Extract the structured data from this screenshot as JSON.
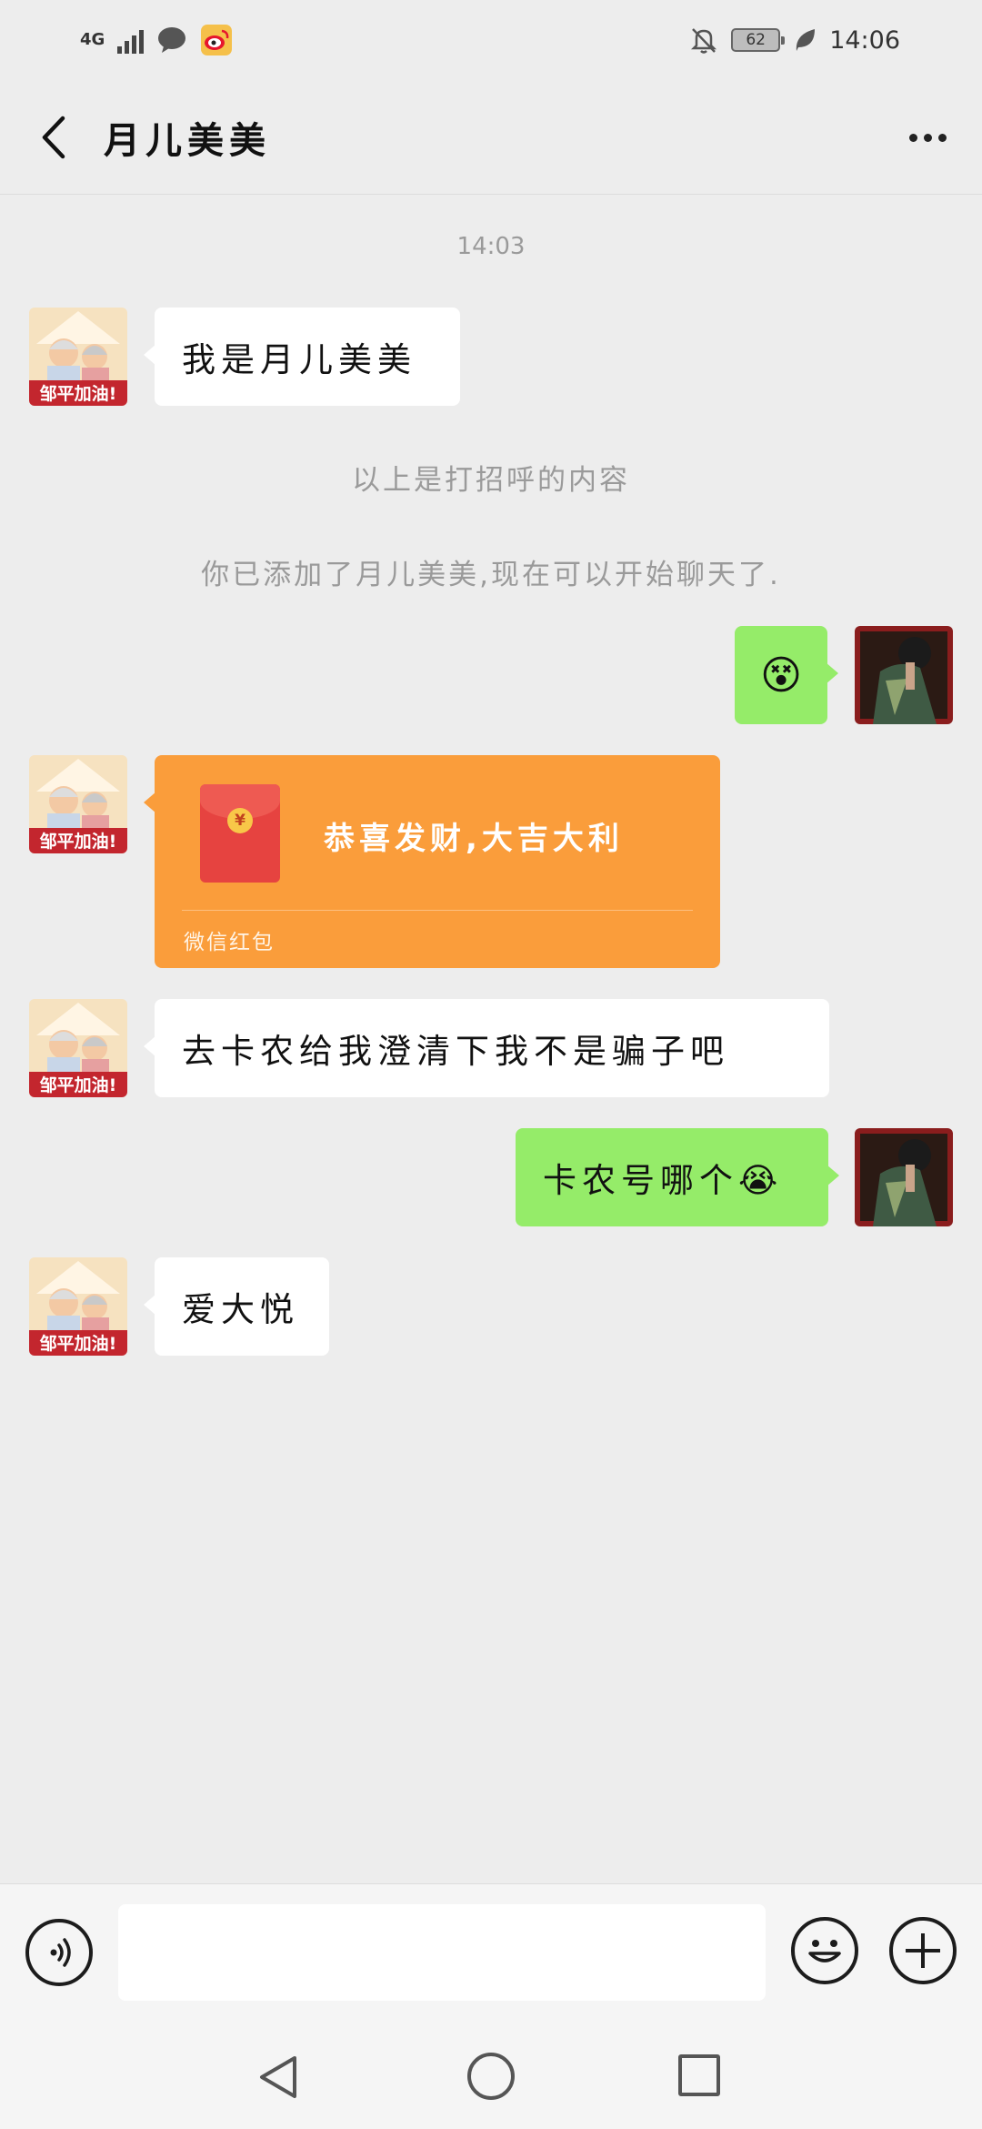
{
  "status_bar": {
    "network": "4G",
    "battery": "62",
    "time": "14:06"
  },
  "header": {
    "title": "月儿美美"
  },
  "chat": {
    "timestamp": "14:03",
    "messages": [
      {
        "side": "left",
        "type": "text",
        "text": "我是月儿美美"
      },
      {
        "side": "system",
        "text": "以上是打招呼的内容"
      },
      {
        "side": "system",
        "text": "你已添加了月儿美美,现在可以开始聊天了."
      },
      {
        "side": "right",
        "type": "emoji",
        "emoji": "😵"
      },
      {
        "side": "left",
        "type": "red_packet",
        "title": "恭喜发财,大吉大利",
        "footer": "微信红包",
        "coin": "¥"
      },
      {
        "side": "left",
        "type": "text",
        "text": "去卡农给我澄清下我不是骗子吧"
      },
      {
        "side": "right",
        "type": "text",
        "text": "卡农号哪个😭"
      },
      {
        "side": "left",
        "type": "text",
        "text": "爱大悦"
      }
    ],
    "left_avatar_caption": "邹平加油!"
  },
  "colors": {
    "background": "#ededed",
    "bubble_left": "#ffffff",
    "bubble_right": "#95ec69",
    "red_packet": "#fa9d3b"
  }
}
